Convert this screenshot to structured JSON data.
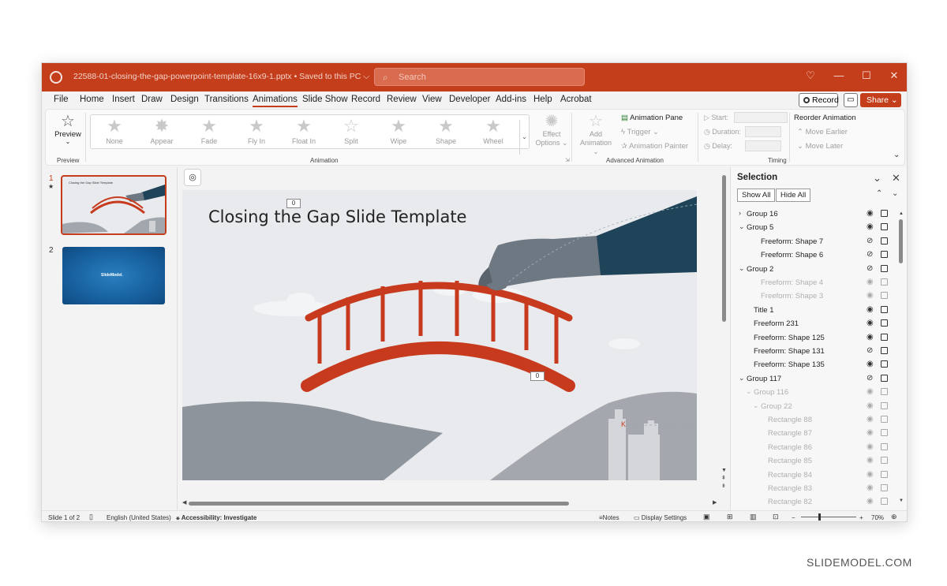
{
  "window": {
    "doc_title": "22588-01-closing-the-gap-powerpoint-template-16x9-1.pptx • Saved to this PC ⌵",
    "search_placeholder": "Search",
    "colors": {
      "accent": "#c43e1c",
      "canvas": "#e8eaed",
      "bridge": "#c73a1e",
      "sleeve": "#1f4358",
      "glove": "#6e7882"
    }
  },
  "menu": {
    "tabs": [
      "File",
      "Home",
      "Insert",
      "Draw",
      "Design",
      "Transitions",
      "Animations",
      "Slide Show",
      "Record",
      "Review",
      "View",
      "Developer",
      "Add-ins",
      "Help",
      "Acrobat"
    ],
    "active_tab": "Animations",
    "record_label": "Record",
    "share_label": "Share ⌄"
  },
  "ribbon": {
    "preview": {
      "label": "Preview",
      "group": "Preview"
    },
    "animation_group_label": "Animation",
    "animations": [
      "None",
      "Appear",
      "Fade",
      "Fly In",
      "Float In",
      "Split",
      "Wipe",
      "Shape",
      "Wheel"
    ],
    "effect_options": [
      "Effect",
      "Options ⌄"
    ],
    "add_animation": [
      "Add",
      "Animation ⌄"
    ],
    "advanced": {
      "animation_pane": "Animation Pane",
      "trigger": "Trigger ⌄",
      "animation_painter": "Animation Painter",
      "group": "Advanced Animation"
    },
    "timing": {
      "start": "Start:",
      "duration": "Duration:",
      "delay": "Delay:",
      "reorder": "Reorder Animation",
      "move_earlier": "Move Earlier",
      "move_later": "Move Later",
      "group": "Timing"
    }
  },
  "slides": {
    "items": [
      {
        "number": "1",
        "star": "★",
        "thumb_title": "Closing the Gap Slide Template"
      },
      {
        "number": "2",
        "thumb_logo": "SlideModel."
      }
    ]
  },
  "slide": {
    "title": "Closing the Gap Slide Template",
    "anim_tags": [
      "0",
      "0"
    ],
    "marker": "K"
  },
  "selection_pane": {
    "title": "Selection",
    "show_all": "Show All",
    "hide_all": "Hide All",
    "items": [
      {
        "name": "Group 16",
        "chev": "›",
        "indent": 0,
        "dim": false,
        "hidden": false
      },
      {
        "name": "Group 5",
        "chev": "⌄",
        "indent": 0,
        "dim": false,
        "hidden": false
      },
      {
        "name": "Freeform: Shape 7",
        "chev": "",
        "indent": 2,
        "dim": false,
        "hidden": true
      },
      {
        "name": "Freeform: Shape 6",
        "chev": "",
        "indent": 2,
        "dim": false,
        "hidden": true
      },
      {
        "name": "Group 2",
        "chev": "⌄",
        "indent": 0,
        "dim": false,
        "hidden": true
      },
      {
        "name": "Freeform: Shape 4",
        "chev": "",
        "indent": 2,
        "dim": true,
        "hidden": false
      },
      {
        "name": "Freeform: Shape 3",
        "chev": "",
        "indent": 2,
        "dim": true,
        "hidden": false
      },
      {
        "name": "Title 1",
        "chev": "",
        "indent": 1,
        "dim": false,
        "hidden": false
      },
      {
        "name": "Freeform 231",
        "chev": "",
        "indent": 1,
        "dim": false,
        "hidden": false
      },
      {
        "name": "Freeform: Shape 125",
        "chev": "",
        "indent": 1,
        "dim": false,
        "hidden": false
      },
      {
        "name": "Freeform: Shape 131",
        "chev": "",
        "indent": 1,
        "dim": false,
        "hidden": true
      },
      {
        "name": "Freeform: Shape 135",
        "chev": "",
        "indent": 1,
        "dim": false,
        "hidden": false
      },
      {
        "name": "Group 117",
        "chev": "⌄",
        "indent": 0,
        "dim": false,
        "hidden": true
      },
      {
        "name": "Group 116",
        "chev": "⌄",
        "indent": 1,
        "dim": true,
        "hidden": false
      },
      {
        "name": "Group 22",
        "chev": "⌄",
        "indent": 2,
        "dim": true,
        "hidden": false
      },
      {
        "name": "Rectangle 88",
        "chev": "",
        "indent": 3,
        "dim": true,
        "hidden": false
      },
      {
        "name": "Rectangle 87",
        "chev": "",
        "indent": 3,
        "dim": true,
        "hidden": false
      },
      {
        "name": "Rectangle 86",
        "chev": "",
        "indent": 3,
        "dim": true,
        "hidden": false
      },
      {
        "name": "Rectangle 85",
        "chev": "",
        "indent": 3,
        "dim": true,
        "hidden": false
      },
      {
        "name": "Rectangle 84",
        "chev": "",
        "indent": 3,
        "dim": true,
        "hidden": false
      },
      {
        "name": "Rectangle 83",
        "chev": "",
        "indent": 3,
        "dim": true,
        "hidden": false
      },
      {
        "name": "Rectangle 82",
        "chev": "",
        "indent": 3,
        "dim": true,
        "hidden": false
      }
    ]
  },
  "status": {
    "slide_info": "Slide 1 of 2",
    "language": "English (United States)",
    "accessibility": "Accessibility: Investigate",
    "notes": "Notes",
    "display_settings": "Display Settings",
    "zoom": "70%"
  },
  "watermark": "SLIDEMODEL.COM"
}
